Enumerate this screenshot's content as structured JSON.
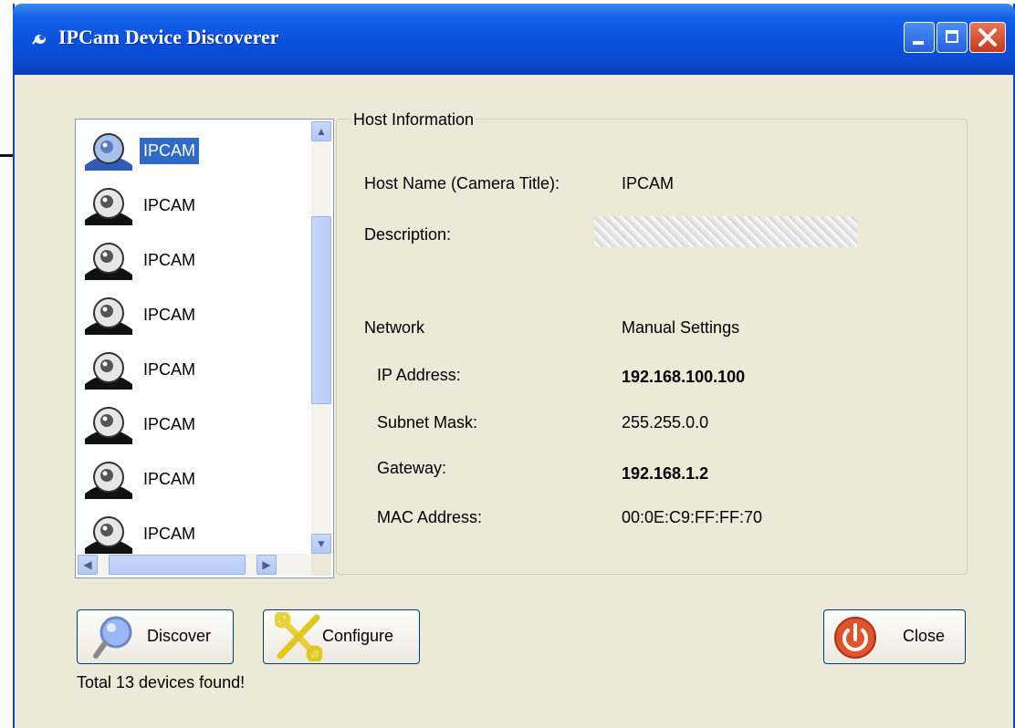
{
  "window": {
    "title": "IPCam Device Discoverer"
  },
  "device_list": {
    "items": [
      {
        "label": "IPCAM",
        "selected": true
      },
      {
        "label": "IPCAM",
        "selected": false
      },
      {
        "label": "IPCAM",
        "selected": false
      },
      {
        "label": "IPCAM",
        "selected": false
      },
      {
        "label": "IPCAM",
        "selected": false
      },
      {
        "label": "IPCAM",
        "selected": false
      },
      {
        "label": "IPCAM",
        "selected": false
      },
      {
        "label": "IPCAM",
        "selected": false
      }
    ]
  },
  "host_info": {
    "legend": "Host Information",
    "host_name_label": "Host Name (Camera Title):",
    "host_name_value": "IPCAM",
    "description_label": "Description:",
    "network_label": "Network",
    "settings_mode": "Manual Settings",
    "ip_label": "IP Address:",
    "ip_value": "192.168.100.100",
    "subnet_label": "Subnet Mask:",
    "subnet_value": "255.255.0.0",
    "gateway_label": "Gateway:",
    "gateway_value": "192.168.1.2",
    "mac_label": "MAC Address:",
    "mac_value": "00:0E:C9:FF:FF:70"
  },
  "buttons": {
    "discover": "Discover",
    "configure": "Configure",
    "close": "Close"
  },
  "status": {
    "text": "Total 13 devices found!"
  },
  "icons": {
    "app": "camera-icon",
    "device": "dome-camera-icon",
    "discover": "magnifier-icon",
    "configure": "tools-icon",
    "close": "power-icon"
  },
  "colors": {
    "titlebar": "#0a50dc",
    "selection": "#316ac5",
    "window_bg": "#ece9d8",
    "close_red": "#c8381a"
  }
}
